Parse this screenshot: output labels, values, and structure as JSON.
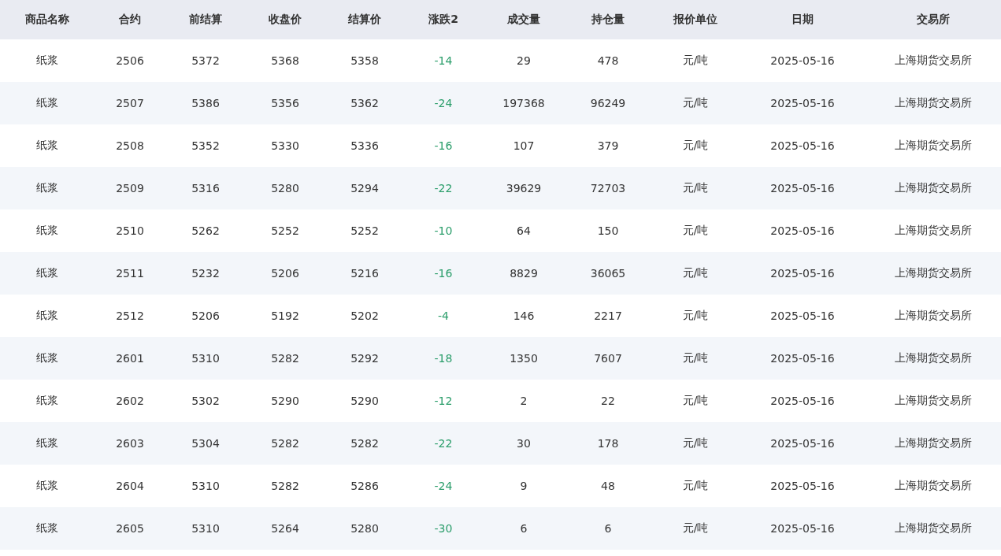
{
  "table": {
    "columns": [
      "商品名称",
      "合约",
      "前结算",
      "收盘价",
      "结算价",
      "涨跌2",
      "成交量",
      "持仓量",
      "报价单位",
      "日期",
      "交易所"
    ],
    "rows": [
      {
        "cells": [
          "纸浆",
          "2506",
          "5372",
          "5368",
          "5358",
          "-14",
          "29",
          "478",
          "元/吨",
          "2025-05-16",
          "上海期货交易所"
        ],
        "color": "#2a9d6a"
      },
      {
        "cells": [
          "纸浆",
          "2507",
          "5386",
          "5356",
          "5362",
          "-24",
          "197368",
          "96249",
          "元/吨",
          "2025-05-16",
          "上海期货交易所"
        ],
        "color": "#2a9d6a"
      },
      {
        "cells": [
          "纸浆",
          "2508",
          "5352",
          "5330",
          "5336",
          "-16",
          "107",
          "379",
          "元/吨",
          "2025-05-16",
          "上海期货交易所"
        ],
        "color": "#2a9d6a"
      },
      {
        "cells": [
          "纸浆",
          "2509",
          "5316",
          "5280",
          "5294",
          "-22",
          "39629",
          "72703",
          "元/吨",
          "2025-05-16",
          "上海期货交易所"
        ],
        "color": "#2a9d6a"
      },
      {
        "cells": [
          "纸浆",
          "2510",
          "5262",
          "5252",
          "5252",
          "-10",
          "64",
          "150",
          "元/吨",
          "2025-05-16",
          "上海期货交易所"
        ],
        "color": "#2a9d6a"
      },
      {
        "cells": [
          "纸浆",
          "2511",
          "5232",
          "5206",
          "5216",
          "-16",
          "8829",
          "36065",
          "元/吨",
          "2025-05-16",
          "上海期货交易所"
        ],
        "color": "#2a9d6a"
      },
      {
        "cells": [
          "纸浆",
          "2512",
          "5206",
          "5192",
          "5202",
          "-4",
          "146",
          "2217",
          "元/吨",
          "2025-05-16",
          "上海期货交易所"
        ],
        "color": "#2a9d6a"
      },
      {
        "cells": [
          "纸浆",
          "2601",
          "5310",
          "5282",
          "5292",
          "-18",
          "1350",
          "7607",
          "元/吨",
          "2025-05-16",
          "上海期货交易所"
        ],
        "color": "#2a9d6a"
      },
      {
        "cells": [
          "纸浆",
          "2602",
          "5302",
          "5290",
          "5290",
          "-12",
          "2",
          "22",
          "元/吨",
          "2025-05-16",
          "上海期货交易所"
        ],
        "color": "#2a9d6a"
      },
      {
        "cells": [
          "纸浆",
          "2603",
          "5304",
          "5282",
          "5282",
          "-22",
          "30",
          "178",
          "元/吨",
          "2025-05-16",
          "上海期货交易所"
        ],
        "color": "#2a9d6a"
      },
      {
        "cells": [
          "纸浆",
          "2604",
          "5310",
          "5282",
          "5286",
          "-24",
          "9",
          "48",
          "元/吨",
          "2025-05-16",
          "上海期货交易所"
        ],
        "color": "#2a9d6a"
      },
      {
        "cells": [
          "纸浆",
          "2605",
          "5310",
          "5264",
          "5280",
          "-30",
          "6",
          "6",
          "元/吨",
          "2025-05-16",
          "上海期货交易所"
        ],
        "color": "#2a9d6a"
      }
    ]
  }
}
